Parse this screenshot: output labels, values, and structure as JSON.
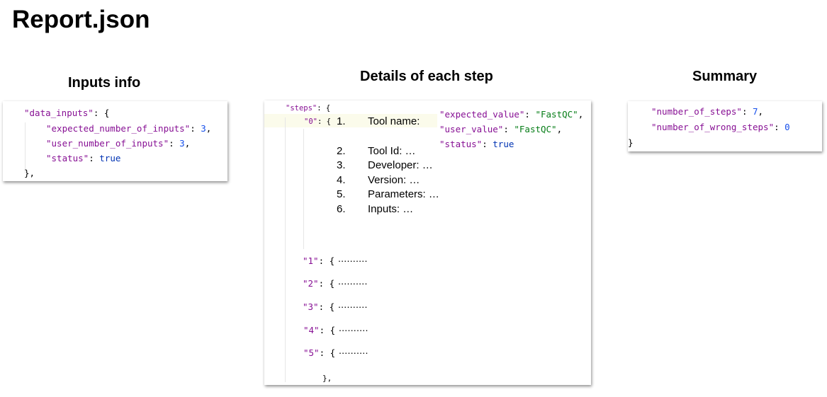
{
  "page": {
    "title": "Report.json"
  },
  "inputs": {
    "title": "Inputs info",
    "lines": [
      {
        "k": "\"data_inputs\"",
        "sep": ": {"
      },
      {
        "k": "\"expected_number_of_inputs\"",
        "sep": ": ",
        "v": "3",
        "end": ","
      },
      {
        "k": "\"user_number_of_inputs\"",
        "sep": ": ",
        "v": "3",
        "end": ","
      },
      {
        "k": "\"status\"",
        "sep": ": ",
        "v": "true"
      },
      {
        "close": "},"
      }
    ]
  },
  "steps": {
    "title": "Details of each step",
    "root_key": "\"steps\"",
    "root_sep": ": {",
    "step0_key": "\"0\"",
    "step0_sep": ": {",
    "detail_list": [
      {
        "n": "1.",
        "text": "Tool name:"
      },
      {
        "n": "2.",
        "text": "Tool Id: …"
      },
      {
        "n": "3.",
        "text": "Developer: …"
      },
      {
        "n": "4.",
        "text": "Version: …"
      },
      {
        "n": "5.",
        "text": "Parameters: …"
      },
      {
        "n": "6.",
        "text": "Inputs: …"
      }
    ],
    "tool_values": [
      {
        "k": "\"expected_value\"",
        "sep": ": ",
        "v": "\"FastQC\"",
        "end": ","
      },
      {
        "k": "\"user_value\"",
        "sep": ": ",
        "v": "\"FastQC\"",
        "end": ","
      },
      {
        "k": "\"status\"",
        "sep": ": ",
        "v": "true"
      }
    ],
    "collapsed": [
      {
        "key": "\"1\"",
        "sep": ": {",
        "dots": "··········"
      },
      {
        "key": "\"2\"",
        "sep": ": {",
        "dots": "··········"
      },
      {
        "key": "\"3\"",
        "sep": ": {",
        "dots": "··········"
      },
      {
        "key": "\"4\"",
        "sep": ": {",
        "dots": "··········"
      },
      {
        "key": "\"5\"",
        "sep": ": {",
        "dots": "··········"
      }
    ],
    "close": "},"
  },
  "summary": {
    "title": "Summary",
    "lines": [
      {
        "k": "\"number_of_steps\"",
        "sep": ": ",
        "v": "7",
        "end": ","
      },
      {
        "k": "\"number_of_wrong_steps\"",
        "sep": ": ",
        "v": "0"
      }
    ],
    "close": "}"
  },
  "colors": {
    "key": "#871094",
    "string": "#067d17",
    "number": "#1750eb",
    "keyword": "#0033b3",
    "highlight_line": "#fbfbeb"
  }
}
